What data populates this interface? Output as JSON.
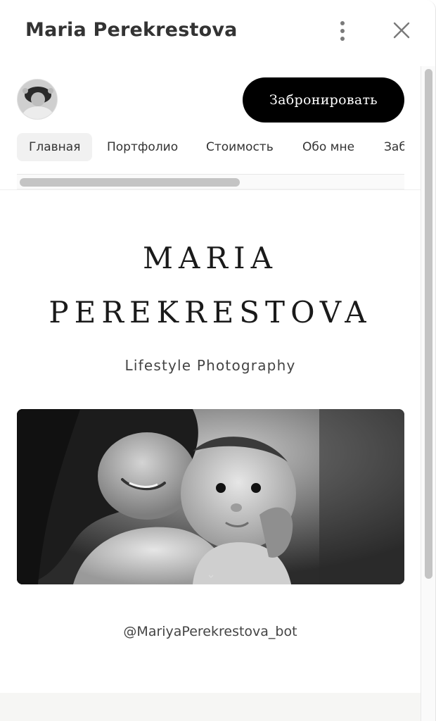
{
  "window": {
    "title": "Maria Perekrestova"
  },
  "icons": {
    "menu": "kebab-menu-icon",
    "close": "close-icon",
    "chevron": "chevron-down-icon"
  },
  "header": {
    "book_button": "Забронировать"
  },
  "tabs": [
    {
      "label": "Главная",
      "active": true
    },
    {
      "label": "Портфолио",
      "active": false
    },
    {
      "label": "Стоимость",
      "active": false
    },
    {
      "label": "Обо мне",
      "active": false
    },
    {
      "label": "Заб",
      "active": false
    }
  ],
  "hero": {
    "name_line1": "MARIA",
    "name_line2": "PEREKRESTOVA",
    "tagline": "Lifestyle Photography"
  },
  "contact": {
    "bot_handle": "@MariyaPerekrestova_bot"
  },
  "colors": {
    "button_bg": "#000000",
    "button_text": "#ffffff",
    "active_tab_bg": "#f1f1f1",
    "scrollbar_thumb": "#c4c4c4"
  }
}
